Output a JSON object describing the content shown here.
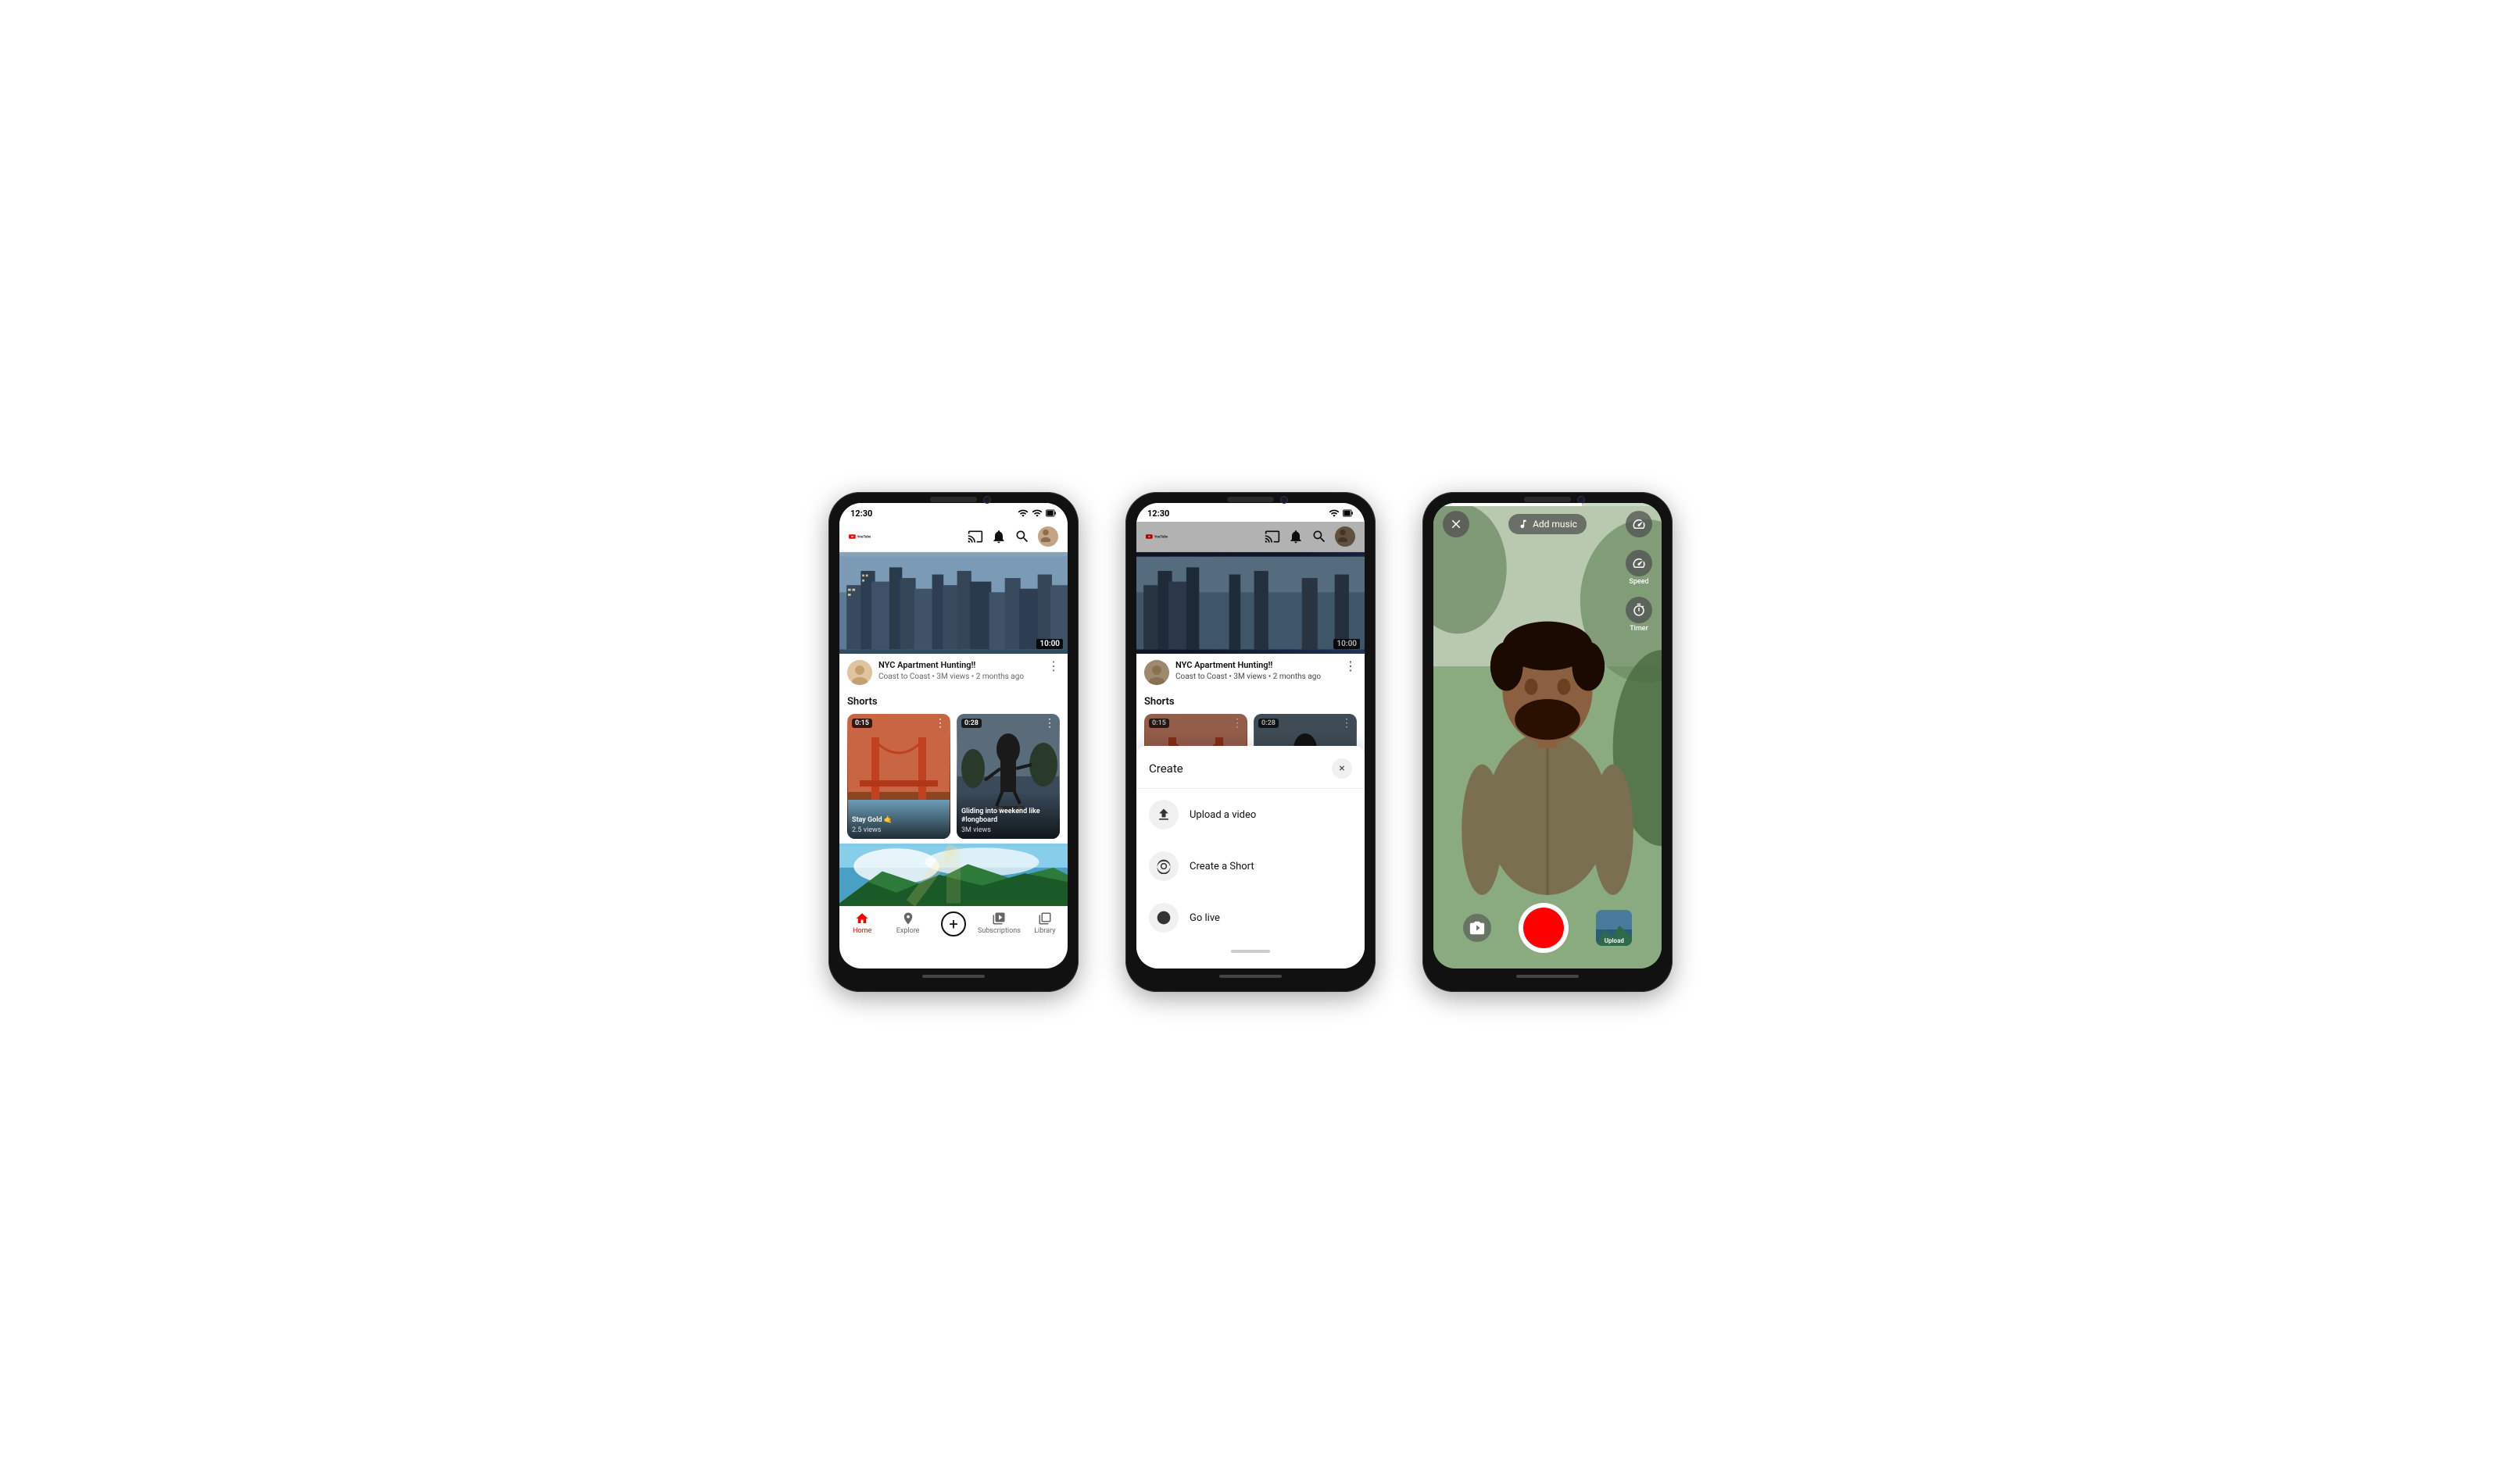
{
  "phones": [
    {
      "id": "phone1",
      "status": {
        "time": "12:30",
        "signal": true,
        "wifi": true,
        "battery": true
      },
      "header": {
        "logo_text": "YouTube",
        "icons": [
          "cast",
          "bell",
          "search",
          "avatar"
        ]
      },
      "video": {
        "duration": "10:00",
        "title": "NYC Apartment Hunting!!",
        "channel": "Coast to Coast",
        "meta": "3M views • 2 months ago"
      },
      "shorts": {
        "section_title": "Shorts",
        "items": [
          {
            "time": "0:15",
            "title": "Stay Gold 🤙",
            "views": "2.5 views"
          },
          {
            "time": "0:28",
            "title": "Gliding into weekend like #longboard",
            "views": "3M views"
          }
        ]
      },
      "nav": {
        "items": [
          "Home",
          "Explore",
          "",
          "Subscriptions",
          "Library"
        ],
        "active": "Home"
      }
    },
    {
      "id": "phone2",
      "status": {
        "time": "12:30"
      },
      "create_menu": {
        "title": "Create",
        "close": "×",
        "items": [
          {
            "icon": "upload",
            "label": "Upload a video"
          },
          {
            "icon": "camera",
            "label": "Create a Short"
          },
          {
            "icon": "live",
            "label": "Go live"
          }
        ]
      }
    },
    {
      "id": "phone3",
      "camera": {
        "add_music": "Add music",
        "speed_label": "Speed",
        "timer_label": "Timer",
        "upload_label": "Upload"
      }
    }
  ]
}
